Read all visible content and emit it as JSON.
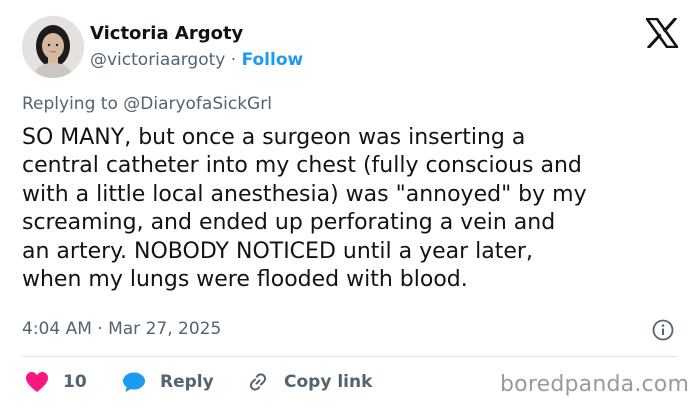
{
  "author": {
    "name": "Victoria Argoty",
    "handle": "@victoriaargoty",
    "separator": "·",
    "follow_label": "Follow"
  },
  "icons": {
    "logo": "x-logo-icon",
    "info": "info-icon",
    "like": "heart-icon",
    "reply": "speech-bubble-icon",
    "copy_link": "link-icon"
  },
  "reply_context": {
    "prefix": "Replying to",
    "handle": "@DiaryofaSickGrl"
  },
  "tweet": {
    "text": "SO MANY, but once a surgeon was inserting a\ncentral catheter into my chest (fully conscious and\nwith a little local anesthesia) was \"annoyed\" by my\nscreaming, and ended up perforating a vein and\nan artery. NOBODY NOTICED until a year later,\nwhen my lungs were flooded with blood.",
    "timestamp": "4:04 AM · Mar 27, 2025"
  },
  "actions": {
    "like_count": "10",
    "reply_label": "Reply",
    "copy_link_label": "Copy link"
  },
  "watermark": "boredpanda.com",
  "colors": {
    "text": "#0f1419",
    "secondary": "#536471",
    "link": "#1d9bf0",
    "like": "#f91880",
    "reply": "#1d9bf0",
    "divider": "#e1e6ea",
    "watermark": "#9a9a9a"
  }
}
